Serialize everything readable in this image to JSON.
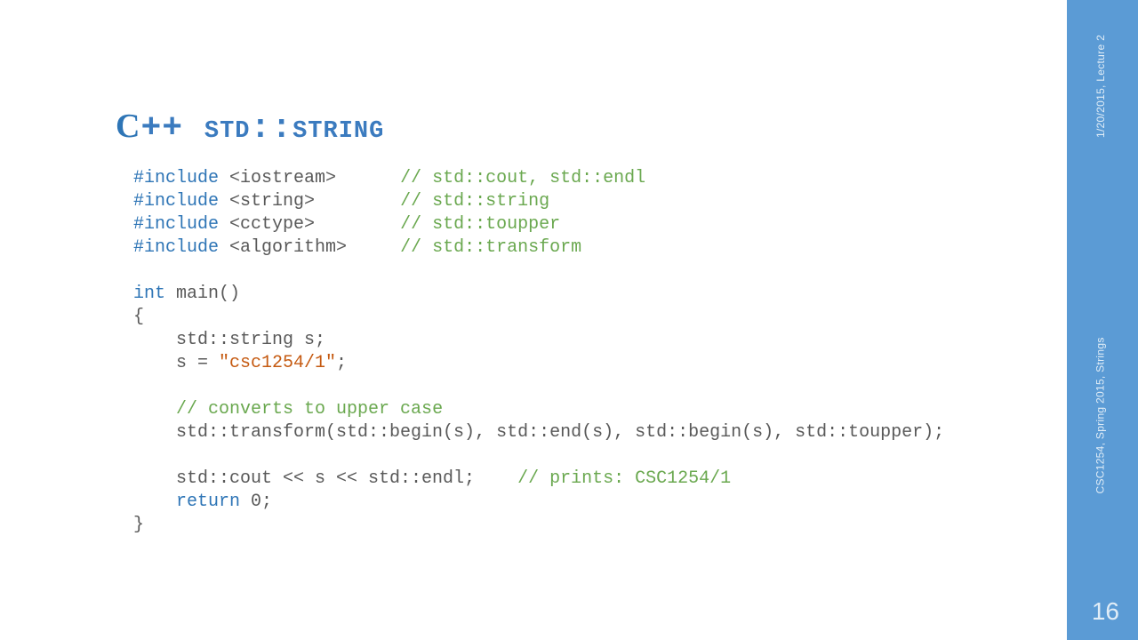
{
  "meta": {
    "date_line": "1/20/2015, Lecture 2",
    "course_line": "CSC1254, Spring 2015, Strings",
    "page_number": "16"
  },
  "title": {
    "prefix": "C",
    "suffix": "++ std::string"
  },
  "code": {
    "l01_a": "#include",
    "l01_b": " <iostream>      ",
    "l01_c": "// std::cout, std::endl",
    "l02_a": "#include",
    "l02_b": " <string>        ",
    "l02_c": "// std::string",
    "l03_a": "#include",
    "l03_b": " <cctype>        ",
    "l03_c": "// std::toupper",
    "l04_a": "#include",
    "l04_b": " <algorithm>     ",
    "l04_c": "// std::transform",
    "l05": "",
    "l06_a": "int",
    "l06_b": " main()",
    "l07": "{",
    "l08": "    std::string s;",
    "l09_a": "    s = ",
    "l09_b": "\"csc1254/1\"",
    "l09_c": ";",
    "l10": "",
    "l11_a": "    ",
    "l11_b": "// converts to upper case",
    "l12": "    std::transform(std::begin(s), std::end(s), std::begin(s), std::toupper);",
    "l13": "",
    "l14_a": "    std::cout << s << std::endl;    ",
    "l14_b": "// prints: CSC1254/1",
    "l15_a": "    ",
    "l15_b": "return",
    "l15_c": " 0;",
    "l16": "}"
  }
}
